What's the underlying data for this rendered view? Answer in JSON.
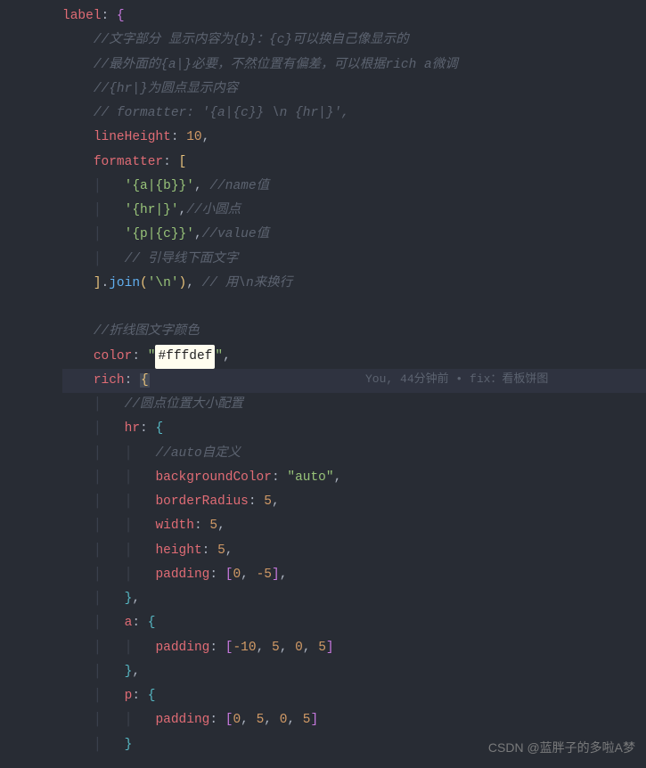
{
  "code": {
    "label_key": "label",
    "comment1": "//文字部分 显示内容为{b}：{c}可以换自己像显示的",
    "comment2": "//最外面的{a|}必要，不然位置有偏差，可以根据rich a微调",
    "comment3": "//{hr|}为圆点显示内容",
    "comment4": "// formatter: '{a|{c}} \\n {hr|}',",
    "lineHeight_key": "lineHeight",
    "lineHeight_val": "10",
    "formatter_key": "formatter",
    "fmt_item1": "'{a|{b}}'",
    "fmt_item1_comment": " //name值",
    "fmt_item2": "'{hr|}'",
    "fmt_item2_comment": "//小圆点",
    "fmt_item3": "'{p|{c}}'",
    "fmt_item3_comment": "//value值",
    "fmt_comment4": "// 引导线下面文字",
    "join_method": "join",
    "join_arg": "'\\n'",
    "join_comment": " // 用\\n来换行",
    "comment_color": "//折线图文字颜色",
    "color_key": "color",
    "color_val": "#fffdef",
    "rich_key": "rich",
    "rich_comment": "//圆点位置大小配置",
    "hr_key": "hr",
    "hr_comment": "//auto自定义",
    "backgroundColor_key": "backgroundColor",
    "backgroundColor_val": "\"auto\"",
    "borderRadius_key": "borderRadius",
    "borderRadius_val": "5",
    "width_key": "width",
    "width_val": "5",
    "height_key": "height",
    "height_val": "5",
    "padding_key": "padding",
    "hr_padding_v1": "0",
    "hr_padding_v2": "-5",
    "a_key": "a",
    "a_padding_v1": "-10",
    "a_padding_v2": "5",
    "a_padding_v3": "0",
    "a_padding_v4": "5",
    "p_key": "p",
    "p_padding_v1": "0",
    "p_padding_v2": "5",
    "p_padding_v3": "0",
    "p_padding_v4": "5"
  },
  "codelens": {
    "author": "You, ",
    "time": "44分钟前",
    "sep": " • ",
    "msg": "fix：看板饼图"
  },
  "watermark": "CSDN @蓝胖子的多啦A梦"
}
